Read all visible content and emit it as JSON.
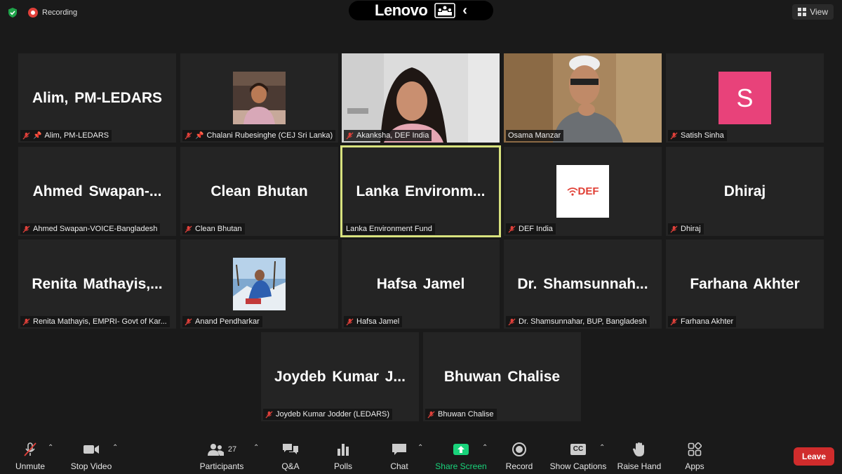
{
  "top": {
    "recording_label": "Recording",
    "brand": "Lenovo",
    "view_label": "View"
  },
  "tiles": [
    {
      "big": "Alim, PM-LEDARS",
      "tag": "Alim, PM-LEDARS"
    },
    {
      "big": "",
      "tag": "Chalani Rubesinghe (CEJ Sri Lanka)"
    },
    {
      "big": "",
      "tag": "Akanksha, DEF India"
    },
    {
      "big": "",
      "tag": "Osama Manzar"
    },
    {
      "big": "",
      "tag": "Satish Sinha",
      "avatar_letter": "S"
    },
    {
      "big": "Ahmed  Swapan-...",
      "tag": "Ahmed Swapan-VOICE-Bangladesh"
    },
    {
      "big": "Clean Bhutan",
      "tag": "Clean Bhutan"
    },
    {
      "big": "Lanka  Environm...",
      "tag": "Lanka Environment Fund"
    },
    {
      "big": "",
      "tag": "DEF India",
      "logo_text": "DEF"
    },
    {
      "big": "Dhiraj",
      "tag": "Dhiraj"
    },
    {
      "big": "Renita  Mathayis,...",
      "tag": "Renita Mathayis, EMPRI- Govt of Kar..."
    },
    {
      "big": "",
      "tag": "Anand Pendharkar"
    },
    {
      "big": "Hafsa Jamel",
      "tag": "Hafsa Jamel"
    },
    {
      "big": "Dr.  Shamsunnah...",
      "tag": "Dr. Shamsunnahar, BUP, Bangladesh"
    },
    {
      "big": "Farhana Akhter",
      "tag": "Farhana Akhter"
    },
    {
      "big": "Joydeb  Kumar  J...",
      "tag": "Joydeb Kumar Jodder (LEDARS)"
    },
    {
      "big": "Bhuwan Chalise",
      "tag": "Bhuwan Chalise"
    }
  ],
  "toolbar": {
    "unmute": "Unmute",
    "stop_video": "Stop Video",
    "participants": "Participants",
    "participants_count": "27",
    "qa": "Q&A",
    "polls": "Polls",
    "chat": "Chat",
    "share_screen": "Share Screen",
    "record": "Record",
    "show_captions": "Show Captions",
    "captions_badge": "CC",
    "raise_hand": "Raise Hand",
    "apps": "Apps",
    "leave": "Leave"
  },
  "colors": {
    "background": "#1a1a1a",
    "tile": "#242424",
    "active_speaker_border": "#d8e27e",
    "share_green": "#19d37b",
    "leave_red": "#d02c2c",
    "avatar_pink": "#e8427a"
  }
}
